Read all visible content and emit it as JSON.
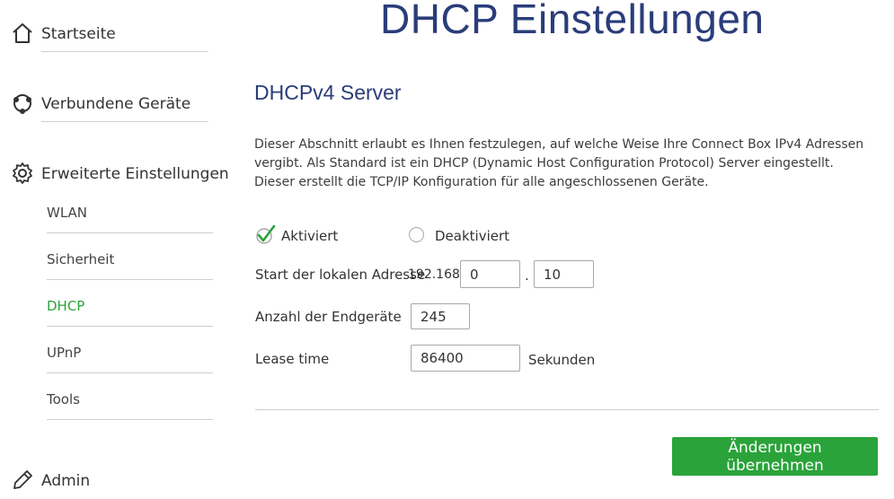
{
  "sidebar": {
    "main_items": [
      {
        "label": "Startseite",
        "icon": "home-icon"
      },
      {
        "label": "Verbundene Geräte",
        "icon": "connected-devices-icon"
      },
      {
        "label": "Erweiterte Einstellungen",
        "icon": "gear-icon"
      }
    ],
    "sub_items": [
      {
        "label": "WLAN"
      },
      {
        "label": "Sicherheit"
      },
      {
        "label": "DHCP",
        "active": true
      },
      {
        "label": "UPnP"
      },
      {
        "label": "Tools"
      }
    ],
    "admin": {
      "label": "Admin",
      "icon": "pencil-icon"
    }
  },
  "page": {
    "title": "DHCP Einstellungen",
    "section_title": "DHCPv4 Server",
    "description": "Dieser Abschnitt erlaubt es Ihnen festzulegen, auf welche Weise Ihre Connect Box IPv4 Adressen vergibt. Als Standard ist ein DHCP (Dynamic Host Configuration Protocol) Server eingestellt. Dieser erstellt die TCP/IP Konfiguration für alle angeschlossenen Geräte.",
    "radio": {
      "enabled_label": "Aktiviert",
      "disabled_label": "Deaktiviert",
      "selected": "Aktiviert"
    },
    "start_address": {
      "label": "Start der lokalen Adresse",
      "prefix": "192.168.",
      "octet3": "0",
      "separator": ".",
      "octet4": "10"
    },
    "device_count": {
      "label": "Anzahl der Endgeräte",
      "value": "245"
    },
    "lease_time": {
      "label": "Lease time",
      "value": "86400",
      "unit": "Sekunden"
    },
    "apply_button": "Änderungen übernehmen"
  },
  "colors": {
    "accent_green": "#2aa33a",
    "title_blue": "#2a3d7a"
  }
}
